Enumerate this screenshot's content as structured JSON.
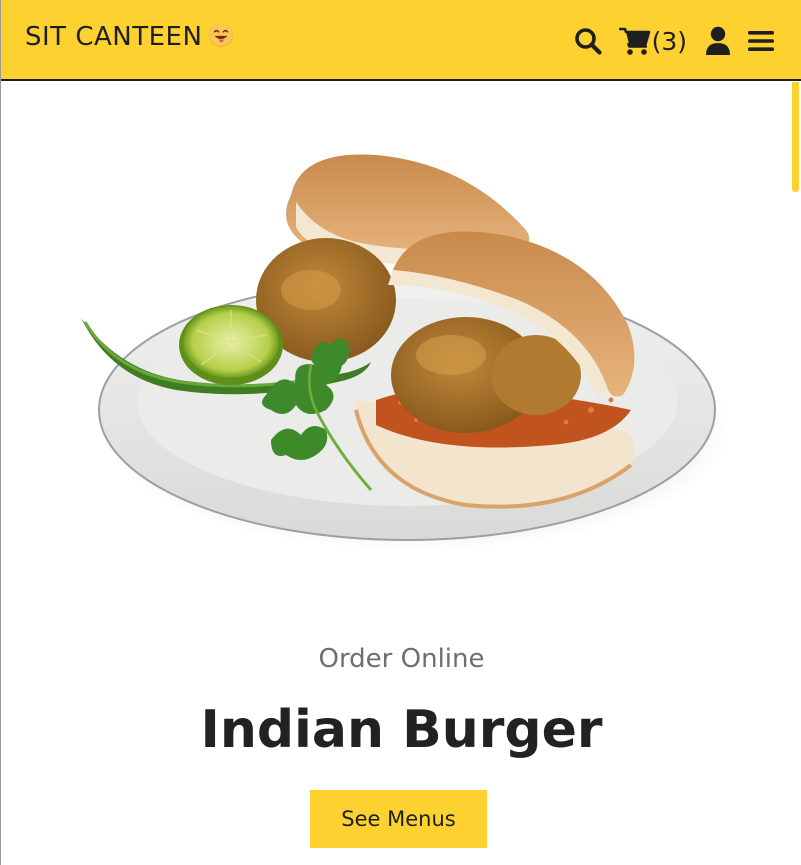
{
  "header": {
    "brand": "SIT CANTEEN",
    "brand_emoji": "face-savoring-food-emoji",
    "search_icon": "search-icon",
    "cart_icon": "cart-icon",
    "cart_count": "(3)",
    "user_icon": "user-icon",
    "menu_icon": "hamburger-menu-icon"
  },
  "hero": {
    "image": "vada-pav-plate",
    "tagline": "Order Online",
    "title": "Indian Burger",
    "cta_label": "See Menus"
  },
  "colors": {
    "accent": "#fdd12f",
    "text_dark": "#222222",
    "text_muted": "#6f6f6f"
  }
}
